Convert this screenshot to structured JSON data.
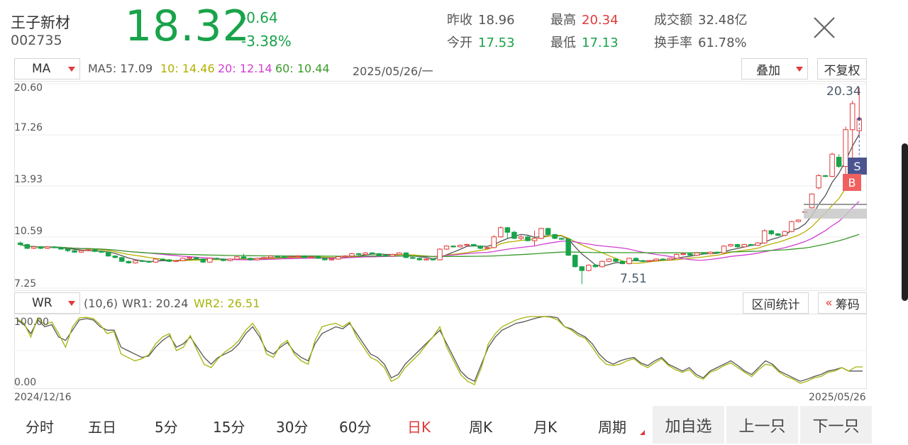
{
  "header": {
    "name": "王子新材",
    "code": "002735",
    "price": "18.32",
    "change": "-0.64",
    "change_pct": "-3.38%",
    "quotes": [
      {
        "label": "昨收",
        "value": "18.96",
        "color": "#555555"
      },
      {
        "label": "今开",
        "value": "17.53",
        "color": "#19a34a"
      },
      {
        "label": "最高",
        "value": "20.34",
        "color": "#e03a3a"
      },
      {
        "label": "最低",
        "value": "17.13",
        "color": "#19a34a"
      },
      {
        "label": "成交额",
        "value": "32.48亿",
        "color": "#555555"
      },
      {
        "label": "换手率",
        "value": "61.78%",
        "color": "#555555"
      }
    ]
  },
  "main_panel": {
    "indicator": "MA",
    "ma5": "MA5: 17.09",
    "ma10": "10: 14.46",
    "ma20": "20: 12.14",
    "ma60": "60: 10.44",
    "date": "2025/05/26/一",
    "overlay_button": "叠加",
    "adjust_button": "不复权",
    "y_labels": [
      "20.60",
      "17.26",
      "13.93",
      "10.59",
      "7.25"
    ],
    "high_annotation": "20.34",
    "low_annotation": "7.51",
    "sell_marker": "S",
    "buy_marker": "B"
  },
  "sub_panel": {
    "indicator": "WR",
    "params": "(10,6)",
    "wr1": "WR1: 20.24",
    "wr2": "WR2: 26.51",
    "range_stats_button": "区间统计",
    "chips_button": "筹码",
    "y_labels": [
      "100.00",
      "0.00"
    ],
    "start_date": "2024/12/16",
    "end_date": "2025/05/26"
  },
  "colors": {
    "up": "#e03a3a",
    "down": "#19a34a",
    "ma5": "#555555",
    "ma10": "#b5b000",
    "ma20": "#d23fd2",
    "ma60": "#3a9a2a",
    "wr1": "#555555",
    "wr2": "#a6b40a"
  },
  "tabs": [
    "分时",
    "五日",
    "5分",
    "15分",
    "30分",
    "60分",
    "日K",
    "周K",
    "月K",
    "周期"
  ],
  "active_tab": "日K",
  "actions": [
    "加自选",
    "上一只",
    "下一只"
  ],
  "chart_data": {
    "type": "candlestick",
    "x_range": [
      "2024/12/16",
      "2025/05/26"
    ],
    "ylim": [
      7.25,
      20.6
    ],
    "y_ticks": [
      20.6,
      17.26,
      13.93,
      10.59,
      7.25
    ],
    "candles": [
      [
        10.2,
        10.1,
        10.3,
        10.0
      ],
      [
        10.1,
        9.85,
        10.15,
        9.8
      ],
      [
        9.85,
        9.95,
        10.0,
        9.8
      ],
      [
        9.95,
        9.85,
        10.0,
        9.8
      ],
      [
        9.85,
        9.95,
        10.0,
        9.8
      ],
      [
        9.95,
        9.9,
        10.0,
        9.85
      ],
      [
        9.9,
        9.8,
        9.95,
        9.75
      ],
      [
        9.8,
        9.7,
        9.85,
        9.6
      ],
      [
        9.7,
        9.6,
        9.75,
        9.55
      ],
      [
        9.6,
        9.7,
        9.75,
        9.55
      ],
      [
        9.7,
        9.75,
        9.8,
        9.65
      ],
      [
        9.75,
        9.65,
        9.8,
        9.6
      ],
      [
        9.65,
        9.6,
        9.7,
        9.55
      ],
      [
        9.6,
        9.35,
        9.65,
        9.3
      ],
      [
        9.35,
        9.25,
        9.4,
        9.2
      ],
      [
        9.25,
        9.0,
        9.3,
        8.95
      ],
      [
        9.0,
        8.9,
        9.05,
        8.85
      ],
      [
        8.9,
        9.05,
        9.1,
        8.85
      ],
      [
        9.05,
        9.0,
        9.1,
        8.95
      ],
      [
        9.0,
        8.95,
        9.05,
        8.9
      ],
      [
        8.95,
        9.15,
        9.2,
        8.9
      ],
      [
        9.15,
        9.1,
        9.2,
        9.05
      ],
      [
        9.1,
        9.0,
        9.15,
        8.95
      ],
      [
        9.0,
        9.05,
        9.1,
        8.95
      ],
      [
        9.05,
        9.2,
        9.25,
        9.0
      ],
      [
        9.2,
        9.25,
        9.3,
        9.15
      ],
      [
        9.25,
        9.15,
        9.3,
        9.1
      ],
      [
        9.15,
        8.95,
        9.2,
        8.9
      ],
      [
        8.95,
        9.2,
        9.25,
        8.9
      ],
      [
        9.2,
        9.15,
        9.25,
        9.1
      ],
      [
        9.15,
        9.05,
        9.2,
        9.0
      ],
      [
        9.05,
        9.15,
        9.2,
        9.0
      ],
      [
        9.15,
        9.3,
        9.35,
        9.1
      ],
      [
        9.3,
        9.2,
        9.5,
        9.15
      ],
      [
        9.2,
        9.1,
        9.25,
        9.05
      ],
      [
        9.1,
        9.2,
        9.25,
        9.05
      ],
      [
        9.2,
        9.25,
        9.3,
        9.15
      ],
      [
        9.25,
        9.35,
        9.4,
        9.2
      ],
      [
        9.35,
        9.3,
        9.4,
        9.25
      ],
      [
        9.3,
        9.25,
        9.35,
        9.2
      ],
      [
        9.25,
        9.3,
        9.35,
        9.2
      ],
      [
        9.3,
        9.35,
        9.4,
        9.25
      ],
      [
        9.35,
        9.25,
        9.4,
        9.2
      ],
      [
        9.25,
        9.3,
        9.35,
        9.2
      ],
      [
        9.3,
        9.2,
        9.35,
        9.15
      ],
      [
        9.2,
        9.1,
        9.25,
        9.05
      ],
      [
        9.1,
        9.15,
        9.2,
        9.05
      ],
      [
        9.15,
        9.3,
        9.35,
        9.1
      ],
      [
        9.3,
        9.35,
        9.4,
        9.25
      ],
      [
        9.35,
        9.5,
        9.55,
        9.3
      ],
      [
        9.5,
        9.45,
        9.55,
        9.4
      ],
      [
        9.45,
        9.55,
        9.6,
        9.4
      ],
      [
        9.55,
        9.5,
        9.6,
        9.45
      ],
      [
        9.5,
        9.4,
        9.55,
        9.35
      ],
      [
        9.4,
        9.35,
        9.45,
        9.3
      ],
      [
        9.35,
        9.45,
        9.5,
        9.3
      ],
      [
        9.45,
        9.55,
        9.6,
        9.4
      ],
      [
        9.55,
        9.25,
        9.6,
        9.2
      ],
      [
        9.25,
        9.2,
        9.3,
        9.15
      ],
      [
        9.2,
        9.1,
        9.25,
        9.05
      ],
      [
        9.1,
        9.15,
        9.2,
        9.05
      ],
      [
        9.15,
        9.1,
        9.2,
        9.05
      ],
      [
        9.1,
        9.8,
        9.85,
        9.05
      ],
      [
        9.8,
        10.0,
        10.05,
        9.75
      ],
      [
        10.0,
        9.95,
        10.05,
        9.9
      ],
      [
        9.95,
        10.05,
        10.1,
        9.9
      ],
      [
        10.05,
        10.1,
        10.15,
        10.0
      ],
      [
        10.1,
        10.0,
        10.15,
        9.95
      ],
      [
        10.0,
        9.85,
        10.05,
        9.8
      ],
      [
        9.85,
        9.9,
        9.95,
        9.8
      ],
      [
        9.9,
        10.6,
        10.7,
        9.85
      ],
      [
        10.6,
        11.2,
        11.3,
        10.55
      ],
      [
        11.2,
        10.9,
        11.25,
        10.5
      ],
      [
        10.9,
        10.5,
        11.0,
        10.45
      ],
      [
        10.5,
        10.6,
        10.7,
        10.4
      ],
      [
        10.6,
        10.35,
        10.7,
        10.3
      ],
      [
        10.35,
        10.5,
        11.0,
        10.0
      ],
      [
        10.5,
        11.15,
        11.2,
        10.45
      ],
      [
        11.15,
        10.75,
        11.2,
        10.7
      ],
      [
        10.75,
        10.5,
        10.8,
        10.45
      ],
      [
        10.5,
        10.45,
        10.55,
        10.4
      ],
      [
        10.45,
        9.4,
        10.5,
        9.35
      ],
      [
        9.4,
        8.65,
        9.45,
        8.6
      ],
      [
        8.65,
        8.4,
        8.7,
        7.51
      ],
      [
        8.4,
        8.75,
        8.8,
        8.35
      ],
      [
        8.75,
        8.65,
        8.8,
        8.6
      ],
      [
        8.65,
        9.0,
        9.05,
        8.6
      ],
      [
        9.0,
        9.15,
        9.2,
        8.95
      ],
      [
        9.15,
        9.0,
        9.2,
        8.95
      ],
      [
        9.0,
        8.85,
        9.05,
        8.8
      ],
      [
        8.85,
        9.2,
        9.25,
        8.8
      ],
      [
        9.2,
        9.05,
        9.25,
        9.0
      ],
      [
        9.05,
        9.0,
        9.1,
        8.95
      ],
      [
        9.0,
        9.05,
        9.1,
        8.95
      ],
      [
        9.05,
        9.15,
        9.2,
        9.0
      ],
      [
        9.15,
        9.1,
        9.2,
        9.05
      ],
      [
        9.1,
        9.2,
        9.25,
        9.05
      ],
      [
        9.2,
        9.45,
        9.5,
        9.15
      ],
      [
        9.45,
        9.5,
        9.55,
        9.4
      ],
      [
        9.5,
        9.4,
        9.55,
        9.35
      ],
      [
        9.4,
        9.55,
        9.6,
        9.35
      ],
      [
        9.55,
        9.5,
        9.6,
        9.45
      ],
      [
        9.5,
        9.6,
        9.65,
        9.45
      ],
      [
        9.6,
        9.55,
        9.65,
        9.5
      ],
      [
        9.55,
        10.0,
        10.05,
        9.5
      ],
      [
        10.0,
        10.1,
        10.15,
        9.95
      ],
      [
        10.1,
        9.95,
        10.15,
        9.9
      ],
      [
        9.95,
        10.1,
        10.15,
        9.9
      ],
      [
        10.1,
        10.05,
        10.15,
        10.0
      ],
      [
        10.05,
        10.2,
        10.25,
        10.0
      ],
      [
        10.2,
        11.0,
        11.1,
        10.15
      ],
      [
        11.0,
        10.8,
        11.05,
        10.7
      ],
      [
        10.8,
        10.7,
        10.85,
        10.65
      ],
      [
        10.7,
        10.95,
        11.0,
        10.65
      ],
      [
        10.95,
        11.6,
        11.65,
        10.9
      ],
      [
        11.6,
        11.7,
        11.75,
        11.55
      ],
      [
        12.2,
        12.25,
        12.3,
        12.15
      ],
      [
        12.5,
        13.4,
        13.45,
        12.45
      ],
      [
        13.8,
        14.6,
        14.7,
        13.7
      ],
      [
        14.6,
        14.55,
        14.65,
        14.5
      ],
      [
        14.55,
        16.0,
        16.1,
        14.5
      ],
      [
        15.8,
        15.2,
        16.0,
        15.1
      ],
      [
        15.2,
        17.6,
        17.8,
        14.0
      ],
      [
        17.6,
        19.3,
        19.5,
        15.5
      ],
      [
        17.53,
        18.32,
        20.34,
        17.13
      ]
    ],
    "wr1": [
      95,
      88,
      75,
      95,
      85,
      88,
      70,
      65,
      80,
      95,
      97,
      95,
      85,
      80,
      80,
      55,
      50,
      45,
      40,
      42,
      55,
      65,
      72,
      55,
      60,
      70,
      55,
      40,
      30,
      40,
      45,
      50,
      60,
      75,
      85,
      70,
      50,
      45,
      55,
      62,
      48,
      40,
      35,
      60,
      75,
      80,
      85,
      82,
      90,
      75,
      60,
      45,
      40,
      30,
      10,
      15,
      30,
      40,
      50,
      60,
      70,
      80,
      60,
      40,
      20,
      10,
      5,
      30,
      55,
      70,
      80,
      85,
      90,
      92,
      95,
      98,
      100,
      100,
      98,
      85,
      82,
      75,
      70,
      60,
      45,
      35,
      30,
      35,
      38,
      40,
      32,
      28,
      35,
      40,
      30,
      25,
      20,
      25,
      15,
      10,
      20,
      25,
      30,
      35,
      28,
      20,
      15,
      25,
      35,
      30,
      20,
      15,
      10,
      5,
      8,
      12,
      15,
      20,
      22,
      25,
      20,
      20,
      20
    ],
    "wr2": [
      97,
      90,
      70,
      98,
      88,
      92,
      75,
      55,
      85,
      98,
      99,
      97,
      88,
      75,
      78,
      45,
      40,
      35,
      38,
      44,
      60,
      70,
      75,
      50,
      55,
      72,
      50,
      30,
      25,
      38,
      48,
      55,
      65,
      80,
      90,
      75,
      45,
      40,
      58,
      65,
      45,
      35,
      30,
      65,
      85,
      88,
      90,
      85,
      92,
      70,
      55,
      40,
      35,
      25,
      5,
      10,
      25,
      35,
      45,
      58,
      70,
      85,
      55,
      35,
      15,
      5,
      0,
      25,
      60,
      75,
      85,
      90,
      95,
      98,
      100,
      100,
      100,
      99,
      95,
      85,
      80,
      72,
      68,
      55,
      40,
      30,
      28,
      30,
      35,
      38,
      30,
      25,
      32,
      38,
      28,
      22,
      18,
      22,
      12,
      8,
      18,
      22,
      28,
      32,
      25,
      18,
      12,
      22,
      30,
      28,
      18,
      12,
      8,
      2,
      5,
      10,
      12,
      18,
      20,
      25,
      20,
      26,
      26
    ]
  }
}
